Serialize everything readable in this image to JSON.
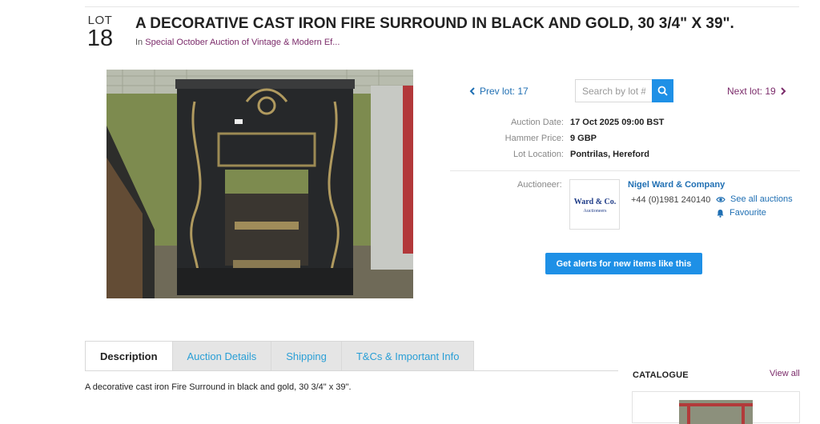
{
  "lot": {
    "label": "LOT",
    "number": "18"
  },
  "title": "A DECORATIVE CAST IRON FIRE SURROUND IN BLACK AND GOLD, 30 3/4\" X 39\".",
  "subtitle": {
    "prefix": "In",
    "auction_link": "Special October Auction of Vintage & Modern Ef..."
  },
  "nav": {
    "prev_label": "Prev lot: 17",
    "next_label": "Next lot: 19",
    "search_placeholder": "Search by lot #"
  },
  "details": {
    "auction_date_label": "Auction Date:",
    "auction_date_value": "17 Oct 2025 09:00 BST",
    "hammer_price_label": "Hammer Price:",
    "hammer_price_value": "9 GBP",
    "location_label": "Lot Location:",
    "location_value": "Pontrilas, Hereford"
  },
  "auctioneer": {
    "label": "Auctioneer:",
    "name": "Nigel Ward & Company",
    "phone": "+44 (0)1981 240140",
    "see_all": "See all auctions",
    "favourite": "Favourite",
    "logo_text": "Ward & Co.",
    "logo_sub": "Auctioneers"
  },
  "alert_button": "Get alerts for new items like this",
  "tabs": [
    "Description",
    "Auction Details",
    "Shipping",
    "T&Cs & Important Info"
  ],
  "description": "A decorative cast iron Fire Surround in black and gold, 30 3/4\" x 39\".",
  "catalogue": {
    "heading": "CATALOGUE",
    "view_all": "View all"
  },
  "colors": {
    "accent_blue": "#1e90e6",
    "link_blue": "#1f6fb3",
    "link_purple": "#7b2b6a"
  },
  "icons": [
    "chevron-left-icon",
    "chevron-right-icon",
    "search-icon",
    "eye-icon",
    "bell-icon"
  ]
}
